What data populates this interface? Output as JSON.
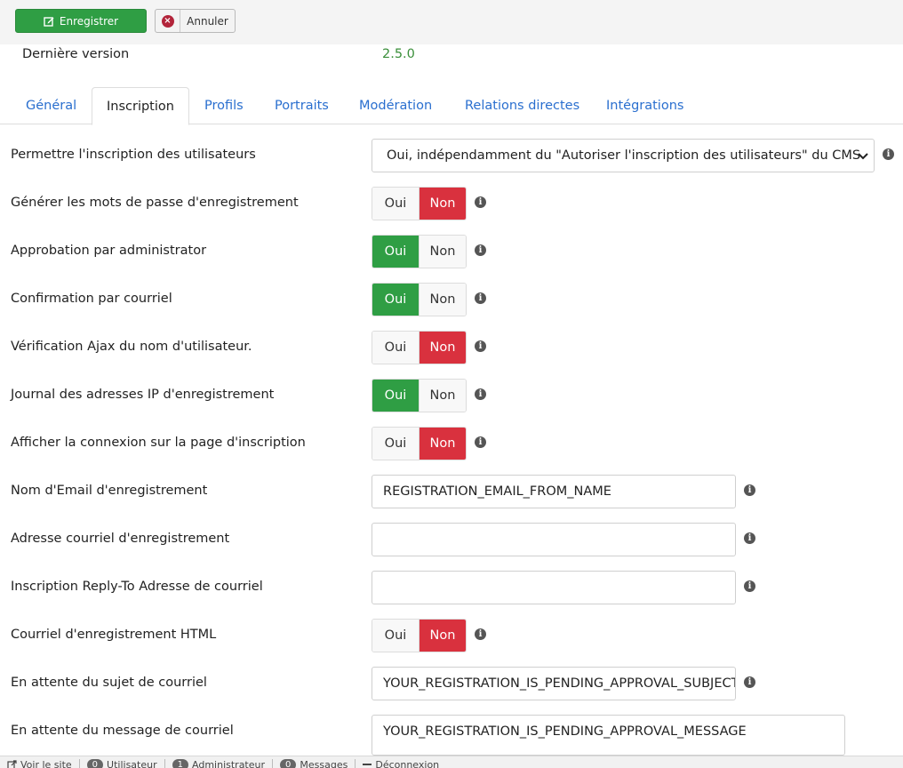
{
  "toolbar": {
    "save_label": "Enregistrer",
    "cancel_label": "Annuler"
  },
  "version": {
    "label": "Dernière version",
    "value": "2.5.0"
  },
  "tabs": [
    {
      "label": "Général"
    },
    {
      "label": "Inscription",
      "active": true
    },
    {
      "label": "Profils"
    },
    {
      "label": "Portraits"
    },
    {
      "label": "Modération"
    },
    {
      "label": "Relations directes"
    },
    {
      "label": "Intégrations"
    }
  ],
  "form": {
    "allow_registration": {
      "label": "Permettre l'inscription des utilisateurs",
      "value": "Oui, indépendamment du \"Autoriser l'inscription des utilisateurs\" du CMS"
    },
    "toggle_yes": "Oui",
    "toggle_no": "Non",
    "generate_passwords": {
      "label": "Générer les mots de passe d'enregistrement",
      "value": "Non"
    },
    "admin_approval": {
      "label": "Approbation par administrator",
      "value": "Oui"
    },
    "email_confirmation": {
      "label": "Confirmation par courriel",
      "value": "Oui"
    },
    "ajax_username_check": {
      "label": "Vérification Ajax du nom d'utilisateur.",
      "value": "Non"
    },
    "log_ip": {
      "label": "Journal des adresses IP d'enregistrement",
      "value": "Oui"
    },
    "show_login": {
      "label": "Afficher la connexion sur la page d'inscription",
      "value": "Non"
    },
    "email_from_name": {
      "label": "Nom d'Email d'enregistrement",
      "value": "REGISTRATION_EMAIL_FROM_NAME"
    },
    "email_address": {
      "label": "Adresse courriel d'enregistrement",
      "value": ""
    },
    "reply_to": {
      "label": "Inscription Reply-To Adresse de courriel",
      "value": ""
    },
    "html_email": {
      "label": "Courriel d'enregistrement HTML",
      "value": "Non"
    },
    "pending_subject": {
      "label": "En attente du sujet de courriel",
      "value": "YOUR_REGISTRATION_IS_PENDING_APPROVAL_SUBJECT"
    },
    "pending_message": {
      "label": "En attente du message de courriel",
      "value": "YOUR_REGISTRATION_IS_PENDING_APPROVAL_MESSAGE"
    }
  },
  "colors": {
    "green": "#2f9e44",
    "red": "#d9313e",
    "link": "#2a6fcf"
  },
  "statusbar": {
    "view_site": "Voir le site",
    "users_count": "0",
    "users_label": "Utilisateur",
    "admins_count": "1",
    "admins_label": "Administrateur",
    "messages_count": "0",
    "messages_label": "Messages",
    "logout": "Déconnexion"
  }
}
